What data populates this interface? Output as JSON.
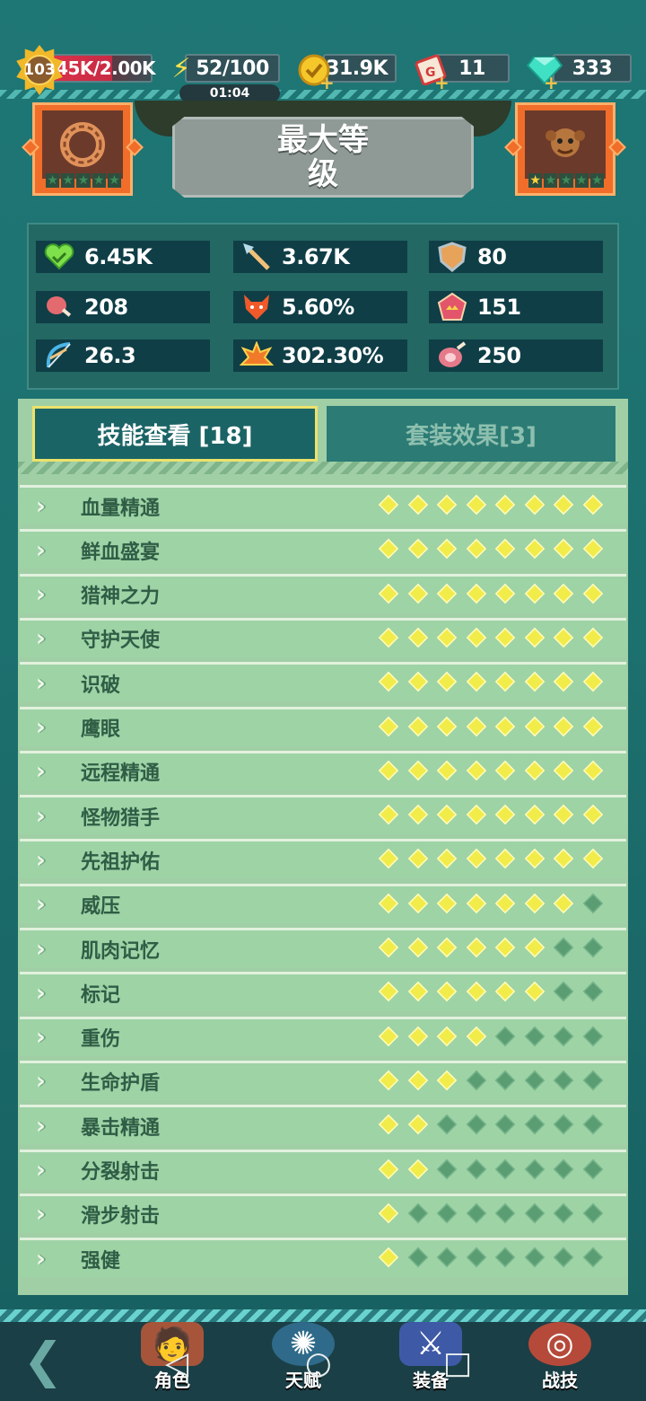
{
  "topbar": {
    "level": "103",
    "xp": ".45K/2.00K",
    "energy": "52/100",
    "energy_timer": "01:04",
    "gold": "31.9K",
    "tickets": "11",
    "gems": "333"
  },
  "header": {
    "title": "最大等级",
    "left_stars": 5,
    "right_stars": 5
  },
  "stats": [
    {
      "icon": "heart-icon",
      "value": "6.45K"
    },
    {
      "icon": "spear-icon",
      "value": "3.67K"
    },
    {
      "icon": "shield-icon",
      "value": "80"
    },
    {
      "icon": "meat-icon",
      "value": "208"
    },
    {
      "icon": "wolf-icon",
      "value": "5.60%"
    },
    {
      "icon": "crown-badge-icon",
      "value": "151"
    },
    {
      "icon": "bow-icon",
      "value": "26.3"
    },
    {
      "icon": "explosion-icon",
      "value": "302.30%"
    },
    {
      "icon": "ham-icon",
      "value": "250"
    }
  ],
  "tabs": {
    "skills": "技能查看 [18]",
    "sets": "套装效果[3]"
  },
  "skills": [
    {
      "name": "血量精通",
      "level": 8
    },
    {
      "name": "鲜血盛宴",
      "level": 8
    },
    {
      "name": "猎神之力",
      "level": 8
    },
    {
      "name": "守护天使",
      "level": 8
    },
    {
      "name": "识破",
      "level": 8
    },
    {
      "name": "鹰眼",
      "level": 8
    },
    {
      "name": "远程精通",
      "level": 8
    },
    {
      "name": "怪物猎手",
      "level": 8
    },
    {
      "name": "先祖护佑",
      "level": 8
    },
    {
      "name": "威压",
      "level": 7
    },
    {
      "name": "肌肉记忆",
      "level": 6
    },
    {
      "name": "标记",
      "level": 6
    },
    {
      "name": "重伤",
      "level": 4
    },
    {
      "name": "生命护盾",
      "level": 3
    },
    {
      "name": "暴击精通",
      "level": 2
    },
    {
      "name": "分裂射击",
      "level": 2
    },
    {
      "name": "滑步射击",
      "level": 1
    },
    {
      "name": "强健",
      "level": 1
    }
  ],
  "skill_max_level": 8,
  "nav": {
    "role": "角色",
    "talent": "天赋",
    "equip": "装备",
    "skill": "战技"
  },
  "colors": {
    "pip_on": "#f2ec4a",
    "pip_off": "#5a9d72",
    "panel": "#a0cfa6",
    "active_tab_border": "#ece26b"
  }
}
